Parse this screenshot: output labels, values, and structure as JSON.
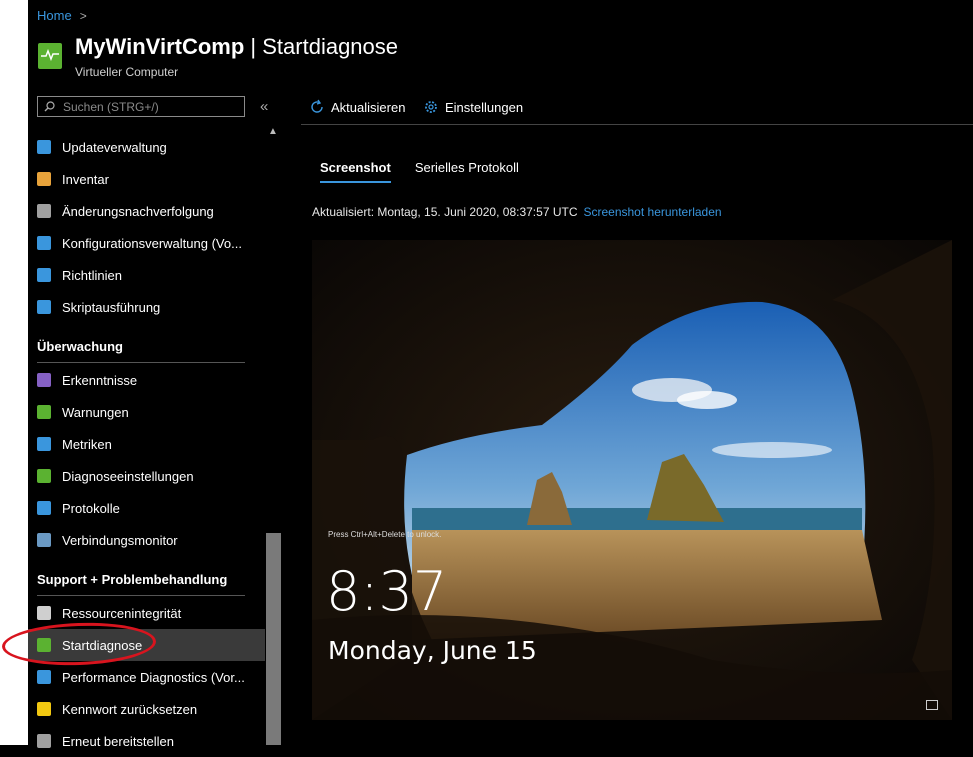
{
  "breadcrumb": {
    "home": "Home",
    "chevron": ">"
  },
  "resource": {
    "name": "MyWinVirtComp",
    "separator": " | ",
    "blade": "Startdiagnose",
    "type": "Virtueller Computer"
  },
  "sidebar": {
    "search_placeholder": "Suchen (STRG+/)",
    "collapse_glyph": "«",
    "items_top": [
      {
        "label": "Updateverwaltung",
        "icon": "update-icon",
        "color": "#3a96dd"
      },
      {
        "label": "Inventar",
        "icon": "inventory-icon",
        "color": "#e8a33b"
      },
      {
        "label": "Änderungsnachverfolgung",
        "icon": "change-tracking-icon",
        "color": "#a0a0a0"
      },
      {
        "label": "Konfigurationsverwaltung (Vo...",
        "icon": "config-icon",
        "color": "#3a96dd"
      },
      {
        "label": "Richtlinien",
        "icon": "policy-icon",
        "color": "#3a96dd"
      },
      {
        "label": "Skriptausführung",
        "icon": "script-icon",
        "color": "#3a96dd"
      }
    ],
    "section_monitoring": "Überwachung",
    "items_monitoring": [
      {
        "label": "Erkenntnisse",
        "icon": "insights-icon",
        "color": "#8661c5"
      },
      {
        "label": "Warnungen",
        "icon": "alerts-icon",
        "color": "#5bb231"
      },
      {
        "label": "Metriken",
        "icon": "metrics-icon",
        "color": "#3a96dd"
      },
      {
        "label": "Diagnoseeinstellungen",
        "icon": "diagnostic-settings-icon",
        "color": "#5bb231"
      },
      {
        "label": "Protokolle",
        "icon": "logs-icon",
        "color": "#3a96dd"
      },
      {
        "label": "Verbindungsmonitor",
        "icon": "connection-monitor-icon",
        "color": "#6b9ac4"
      }
    ],
    "section_support": "Support + Problembehandlung",
    "items_support": [
      {
        "label": "Ressourcenintegrität",
        "icon": "heart-icon",
        "color": "#cfcfcf"
      },
      {
        "label": "Startdiagnose",
        "icon": "boot-diagnostics-icon",
        "color": "#5bb231",
        "active": true
      },
      {
        "label": "Performance Diagnostics (Vor...",
        "icon": "performance-icon",
        "color": "#3a96dd"
      },
      {
        "label": "Kennwort zurücksetzen",
        "icon": "key-icon",
        "color": "#f2c811"
      },
      {
        "label": "Erneut bereitstellen",
        "icon": "redeploy-icon",
        "color": "#a0a0a0"
      }
    ]
  },
  "toolbar": {
    "refresh": "Aktualisieren",
    "settings": "Einstellungen"
  },
  "tabs": [
    {
      "label": "Screenshot",
      "active": true
    },
    {
      "label": "Serielles Protokoll",
      "active": false
    }
  ],
  "updated": {
    "text": "Aktualisiert: Montag, 15. Juni 2020, 08:37:57 UTC",
    "link": "Screenshot herunterladen"
  },
  "lockscreen": {
    "hint": "Press Ctrl+Alt+Delete to unlock.",
    "time": "8:37",
    "date": "Monday, June 15"
  },
  "colors": {
    "accent": "#3a96dd",
    "annotation": "#d8141e"
  }
}
